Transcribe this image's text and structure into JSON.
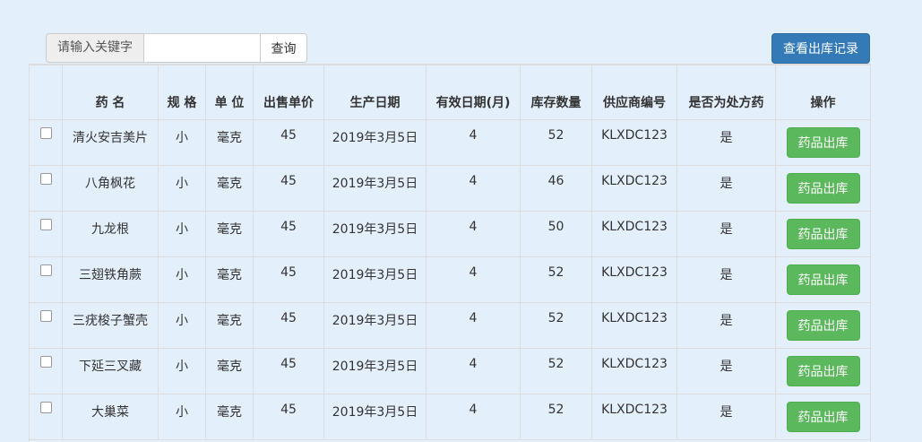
{
  "search": {
    "label": "请输入关键字",
    "value": "",
    "button_label": "查询"
  },
  "records_button_label": "查看出库记录",
  "table": {
    "headers": [
      "药 名",
      "规 格",
      "单 位",
      "出售单价",
      "生产日期",
      "有效日期(月)",
      "库存数量",
      "供应商编号",
      "是否为处方药",
      "操作"
    ],
    "rows": [
      {
        "name": "清火安吉美片",
        "spec": "小",
        "unit": "毫克",
        "price": "45",
        "date": "2019年3月5日",
        "valid": "4",
        "stock": "52",
        "supplier": "KLXDC123",
        "rx": "是",
        "action": "药品出库"
      },
      {
        "name": "八角枫花",
        "spec": "小",
        "unit": "毫克",
        "price": "45",
        "date": "2019年3月5日",
        "valid": "4",
        "stock": "46",
        "supplier": "KLXDC123",
        "rx": "是",
        "action": "药品出库"
      },
      {
        "name": "九龙根",
        "spec": "小",
        "unit": "毫克",
        "price": "45",
        "date": "2019年3月5日",
        "valid": "4",
        "stock": "50",
        "supplier": "KLXDC123",
        "rx": "是",
        "action": "药品出库"
      },
      {
        "name": "三翅铁角蕨",
        "spec": "小",
        "unit": "毫克",
        "price": "45",
        "date": "2019年3月5日",
        "valid": "4",
        "stock": "52",
        "supplier": "KLXDC123",
        "rx": "是",
        "action": "药品出库"
      },
      {
        "name": "三疣梭子蟹壳",
        "spec": "小",
        "unit": "毫克",
        "price": "45",
        "date": "2019年3月5日",
        "valid": "4",
        "stock": "52",
        "supplier": "KLXDC123",
        "rx": "是",
        "action": "药品出库"
      },
      {
        "name": "下延三叉藏",
        "spec": "小",
        "unit": "毫克",
        "price": "45",
        "date": "2019年3月5日",
        "valid": "4",
        "stock": "52",
        "supplier": "KLXDC123",
        "rx": "是",
        "action": "药品出库"
      },
      {
        "name": "大巢菜",
        "spec": "小",
        "unit": "毫克",
        "price": "45",
        "date": "2019年3月5日",
        "valid": "4",
        "stock": "52",
        "supplier": "KLXDC123",
        "rx": "是",
        "action": "药品出库"
      }
    ]
  }
}
